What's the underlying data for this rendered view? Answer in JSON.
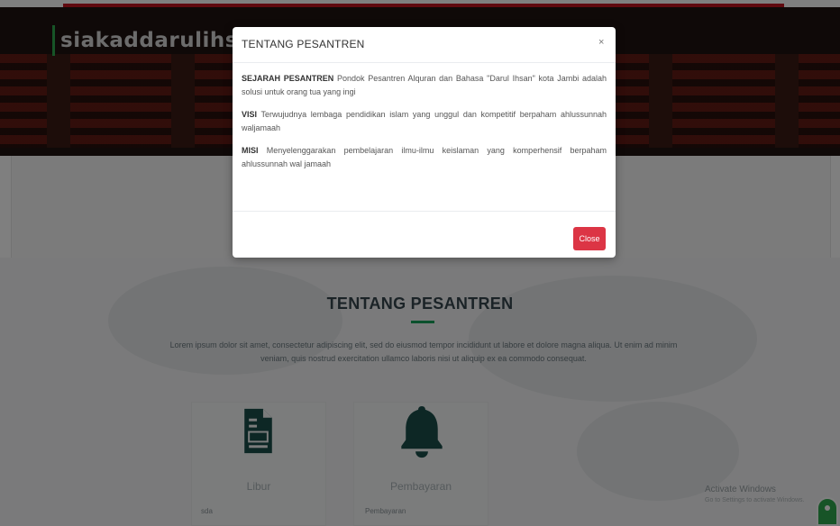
{
  "brand": {
    "name": "siakaddarulihsan"
  },
  "topnav": {
    "items": [
      "",
      "",
      "",
      ""
    ]
  },
  "about": {
    "title": "TENTANG PESANTREN",
    "text": "Lorem ipsum dolor sit amet, consectetur adipiscing elit, sed do eiusmod tempor incididunt ut labore et dolore magna aliqua. Ut enim ad minim veniam, quis nostrud exercitation ullamco laboris nisi ut aliquip ex ea commodo consequat."
  },
  "cards": [
    {
      "icon": "document-icon",
      "title": "Libur",
      "desc": "sda"
    },
    {
      "icon": "bell-icon",
      "title": "Pembayaran",
      "desc": "Pembayaran"
    }
  ],
  "windows_notice": {
    "line1": "Activate Windows",
    "line2": "Go to Settings to activate Windows."
  },
  "modal": {
    "title": "TENTANG PESANTREN",
    "close_symbol": "×",
    "sejarah": {
      "label": "SEJARAH PESANTREN",
      "text": " Pondok Pesantren Alquran dan Bahasa \"Darul Ihsan\" kota Jambi adalah solusi untuk orang tua yang ingi"
    },
    "visi": {
      "label": "VISI",
      "text": " Terwujudnya lembaga pendidikan islam yang unggul dan kompetitif berpaham ahlussunnah waljamaah"
    },
    "misi": {
      "label": "MISI",
      "text": " Menyelenggarakan pembelajaran ilmu-ilmu keislaman yang komperhensif berpaham ahlussunnah wal jamaah"
    },
    "close_label": "Close"
  },
  "colors": {
    "accent_green": "#2ea84f",
    "danger_red": "#dc3545",
    "hero_dark": "#1f1210"
  }
}
